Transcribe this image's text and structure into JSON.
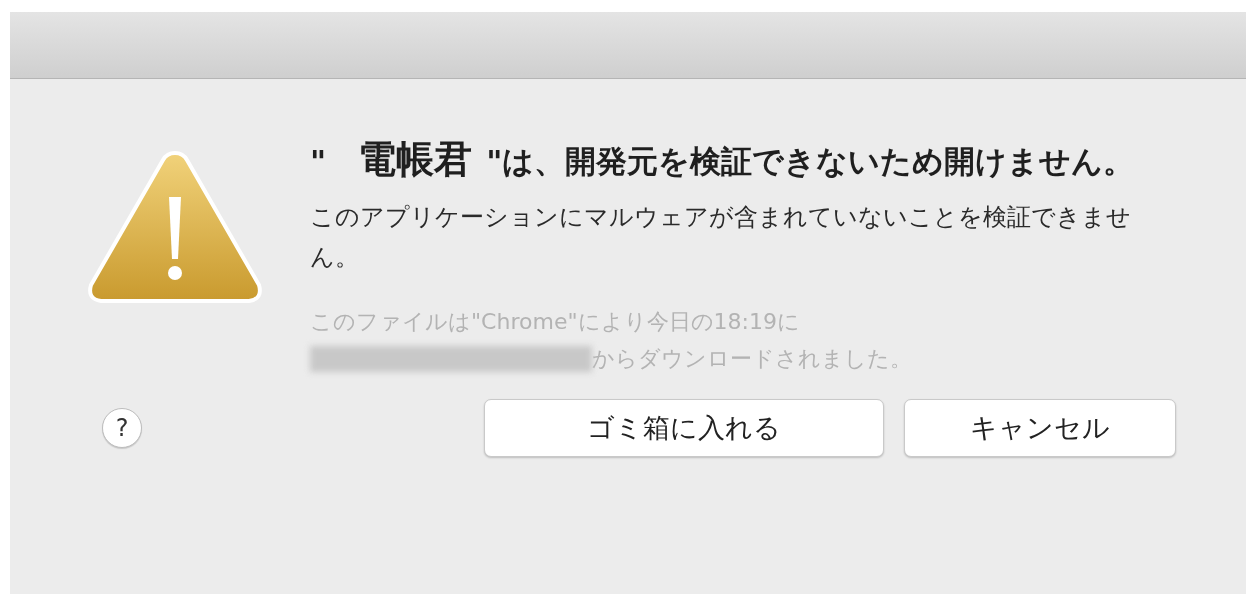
{
  "dialog": {
    "heading": {
      "open_quote": "\"",
      "app_name": "電帳君",
      "rest": "\"は、開発元を検証できないため開けません。"
    },
    "message": "このアプリケーションにマルウェアが含まれていないことを検証できません。",
    "source_line_1": "このファイルは\"Chrome\"により今日の18:19に",
    "source_line_2": "からダウンロードされました。",
    "help": "?",
    "buttons": [
      {
        "label": "ゴミ箱に入れる"
      },
      {
        "label": "キャンセル"
      }
    ]
  }
}
